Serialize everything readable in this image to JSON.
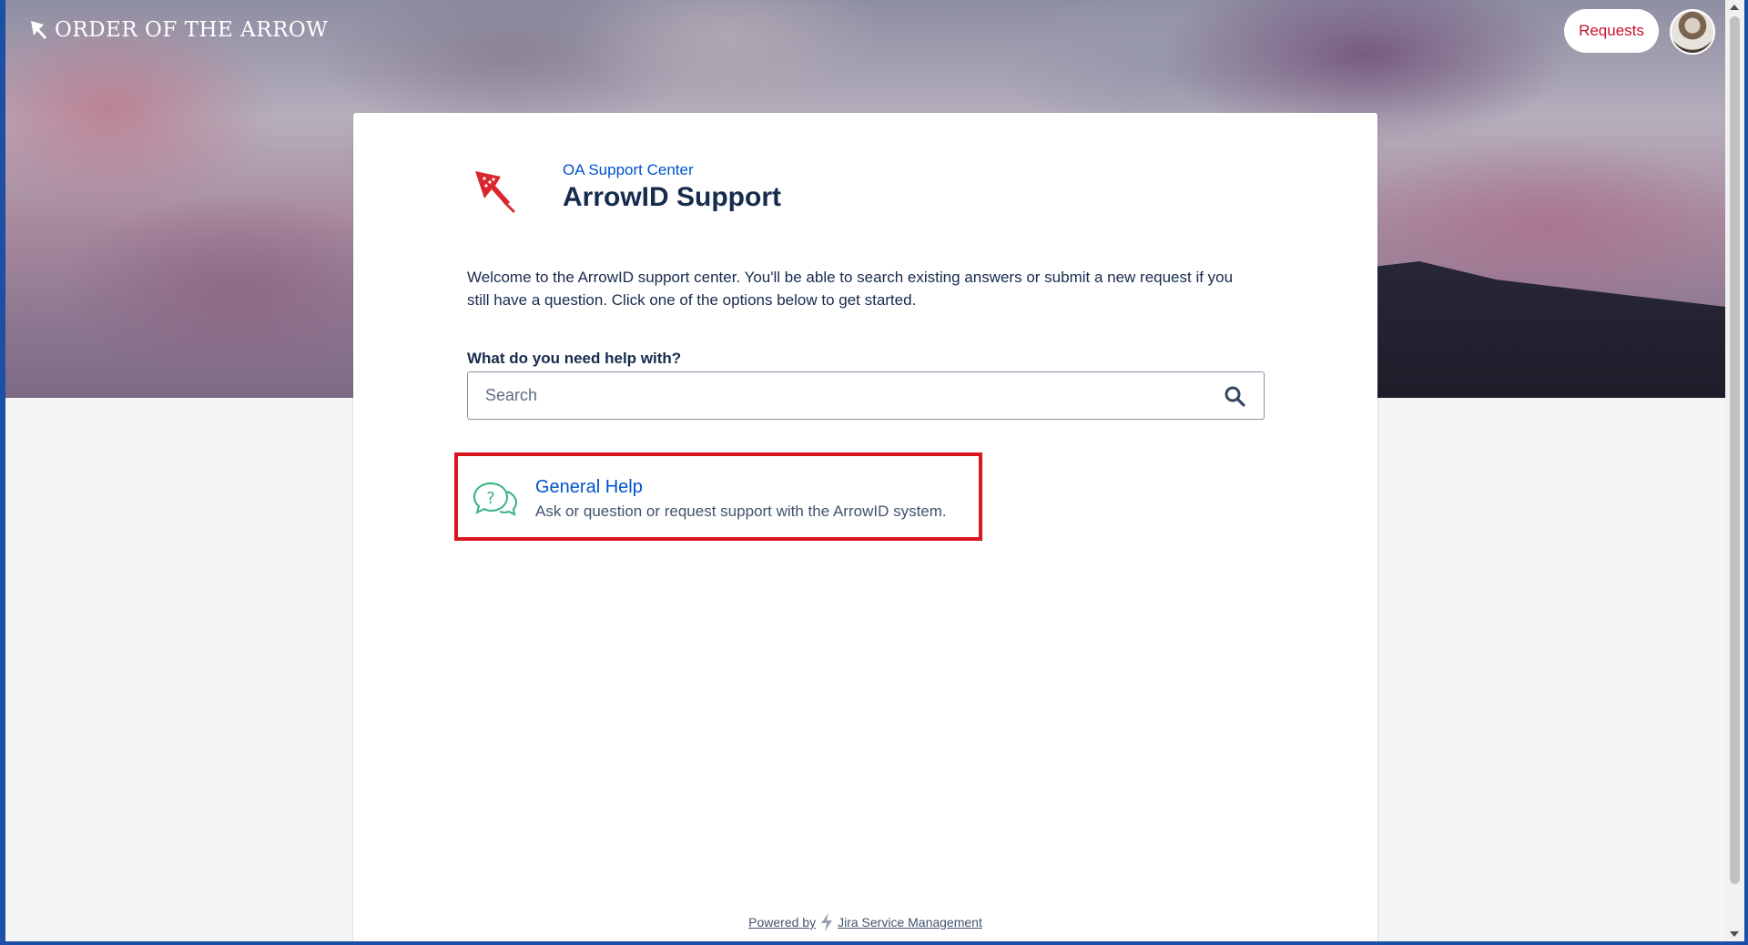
{
  "header": {
    "brand_name": "ORDER OF THE ARROW",
    "requests_label": "Requests"
  },
  "portal": {
    "help_center_link": "OA Support Center",
    "title": "ArrowID Support",
    "welcome": "Welcome to the ArrowID support center. You'll be able to search existing answers or submit a new request if you still have a question. Click one of the options below to get started."
  },
  "search": {
    "label": "What do you need help with?",
    "placeholder": "Search"
  },
  "request_types": [
    {
      "title": "General Help",
      "description": "Ask or question or request support with the ArrowID system.",
      "icon": "question-chat-icon"
    }
  ],
  "footer": {
    "powered_by": "Powered by",
    "product": "Jira Service Management"
  },
  "colors": {
    "accent": "#0052cc",
    "brand_red": "#c8102e",
    "highlight_border": "#d9161e"
  }
}
